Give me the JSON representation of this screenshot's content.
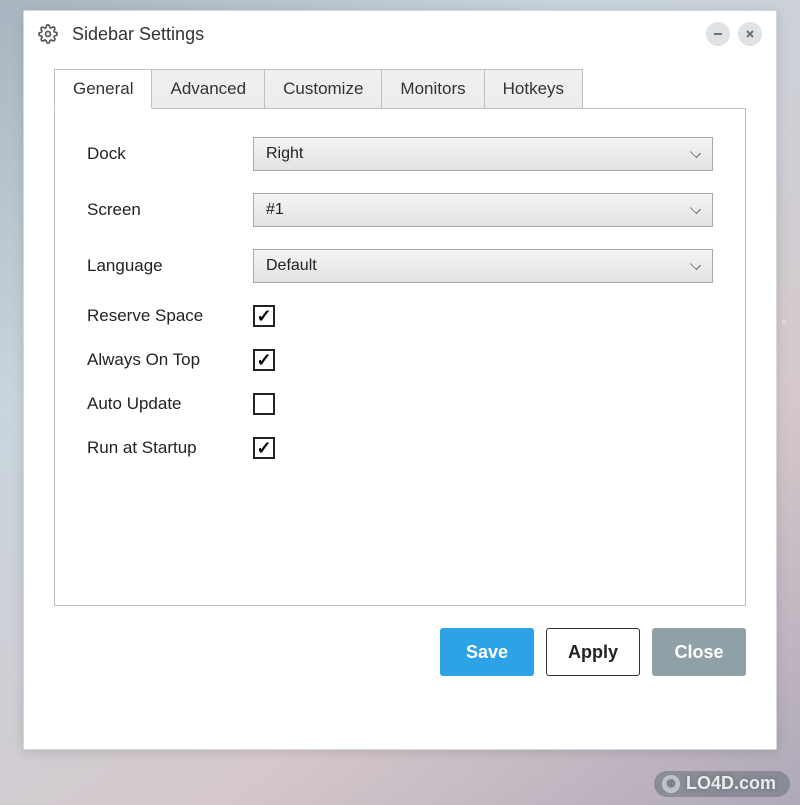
{
  "window": {
    "title": "Sidebar Settings"
  },
  "tabs": [
    {
      "label": "General",
      "active": true
    },
    {
      "label": "Advanced",
      "active": false
    },
    {
      "label": "Customize",
      "active": false
    },
    {
      "label": "Monitors",
      "active": false
    },
    {
      "label": "Hotkeys",
      "active": false
    }
  ],
  "general": {
    "dock": {
      "label": "Dock",
      "value": "Right"
    },
    "screen": {
      "label": "Screen",
      "value": "#1"
    },
    "language": {
      "label": "Language",
      "value": "Default"
    },
    "reserve": {
      "label": "Reserve Space",
      "checked": true
    },
    "ontop": {
      "label": "Always On Top",
      "checked": true
    },
    "update": {
      "label": "Auto Update",
      "checked": false
    },
    "startup": {
      "label": "Run at Startup",
      "checked": true
    }
  },
  "buttons": {
    "save": "Save",
    "apply": "Apply",
    "close": "Close"
  },
  "watermark": "LO4D.com"
}
